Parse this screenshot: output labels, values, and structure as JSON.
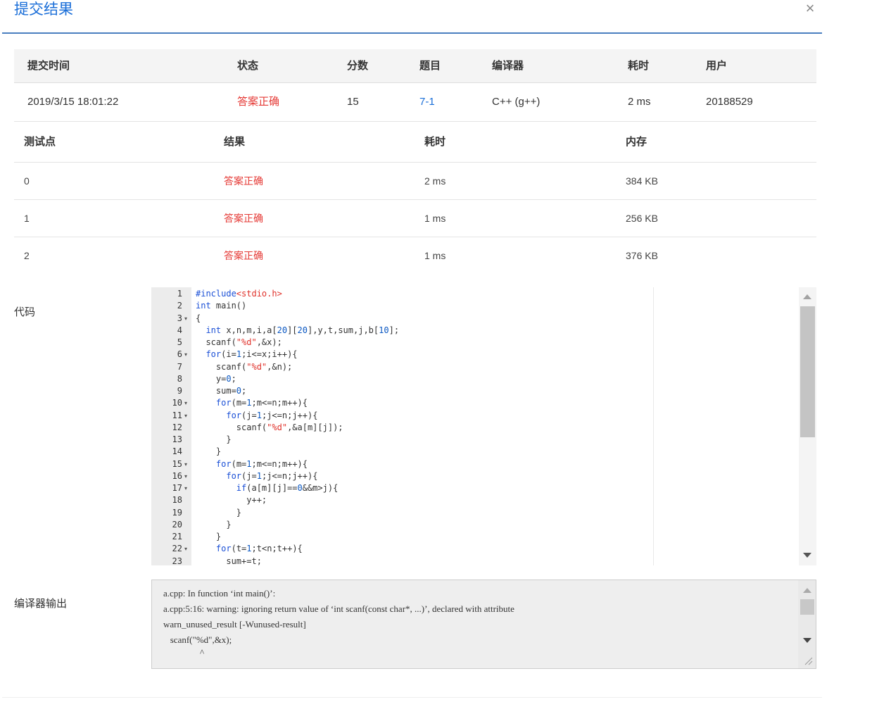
{
  "dialog": {
    "title": "提交结果",
    "close_glyph": "×"
  },
  "summary": {
    "headers": [
      "提交时间",
      "状态",
      "分数",
      "题目",
      "编译器",
      "耗时",
      "用户"
    ],
    "row": {
      "time": "2019/3/15 18:01:22",
      "status": "答案正确",
      "score": "15",
      "problem": "7-1",
      "compiler": "C++ (g++)",
      "elapsed": "2 ms",
      "user": "20188529"
    }
  },
  "tests": {
    "headers": [
      "测试点",
      "结果",
      "耗时",
      "内存"
    ],
    "rows": [
      {
        "id": "0",
        "result": "答案正确",
        "time": "2 ms",
        "memory": "384 KB"
      },
      {
        "id": "1",
        "result": "答案正确",
        "time": "1 ms",
        "memory": "256 KB"
      },
      {
        "id": "2",
        "result": "答案正确",
        "time": "1 ms",
        "memory": "376 KB"
      }
    ]
  },
  "code_label": "代码",
  "code_lines": [
    "#include<stdio.h>",
    "int main()",
    "{",
    "  int x,n,m,i,a[20][20],y,t,sum,j,b[10];",
    "  scanf(\"%d\",&x);",
    "  for(i=1;i<=x;i++){",
    "    scanf(\"%d\",&n);",
    "    y=0;",
    "    sum=0;",
    "    for(m=1;m<=n;m++){",
    "      for(j=1;j<=n;j++){",
    "        scanf(\"%d\",&a[m][j]);",
    "      }",
    "    }",
    "    for(m=1;m<=n;m++){",
    "      for(j=1;j<=n;j++){",
    "        if(a[m][j]==0&&m>j){",
    "          y++;",
    "        }",
    "      }",
    "    }",
    "    for(t=1;t<n;t++){",
    "      sum+=t;"
  ],
  "code_line_numbers": [
    "1",
    "2",
    "3",
    "4",
    "5",
    "6",
    "7",
    "8",
    "9",
    "10",
    "11",
    "12",
    "13",
    "14",
    "15",
    "16",
    "17",
    "18",
    "19",
    "20",
    "21",
    "22",
    "23"
  ],
  "fold_marker": "▾",
  "compiler_label": "编译器输出",
  "compiler_output": [
    "a.cpp: In function ‘int main()’:",
    "a.cpp:5:16: warning: ignoring return value of ‘int scanf(const char*, ...)’, declared with attribute",
    "warn_unused_result [-Wunused-result]",
    "   scanf(\"%d\",&x);",
    "                ^"
  ]
}
